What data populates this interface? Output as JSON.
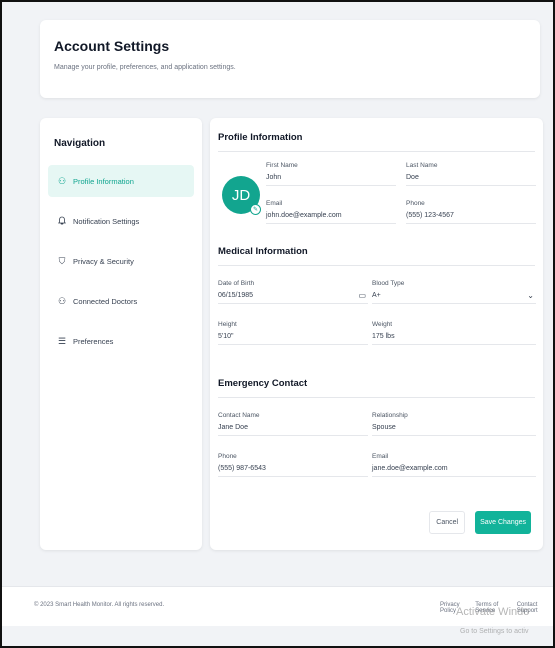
{
  "header": {
    "title": "Account Settings",
    "subtitle": "Manage your profile, preferences, and application settings."
  },
  "navigation": {
    "title": "Navigation",
    "items": [
      {
        "label": "Profile Information",
        "icon": "user-icon",
        "glyph": "⚇"
      },
      {
        "label": "Notification Settings",
        "icon": "bell-icon",
        "glyph": "🔔"
      },
      {
        "label": "Privacy & Security",
        "icon": "shield-icon",
        "glyph": "⛉"
      },
      {
        "label": "Connected Doctors",
        "icon": "users-icon",
        "glyph": "⚇"
      },
      {
        "label": "Preferences",
        "icon": "sliders-icon",
        "glyph": "☰"
      }
    ]
  },
  "profile": {
    "title": "Profile Information",
    "avatar_initials": "JD",
    "first_name_label": "First Name",
    "first_name": "John",
    "last_name_label": "Last Name",
    "last_name": "Doe",
    "email_label": "Email",
    "email": "john.doe@example.com",
    "phone_label": "Phone",
    "phone": "(555) 123-4567"
  },
  "medical": {
    "title": "Medical Information",
    "dob_label": "Date of Birth",
    "dob": "06/15/1985",
    "blood_label": "Blood Type",
    "blood": "A+",
    "height_label": "Height",
    "height": "5'10\"",
    "weight_label": "Weight",
    "weight": "175 lbs"
  },
  "emergency": {
    "title": "Emergency Contact",
    "contact_label": "Contact Name",
    "contact": "Jane Doe",
    "relationship_label": "Relationship",
    "relationship": "Spouse",
    "phone_label": "Phone",
    "phone": "(555) 987-6543",
    "email_label": "Email",
    "email": "jane.doe@example.com"
  },
  "actions": {
    "cancel": "Cancel",
    "save": "Save Changes"
  },
  "footer": {
    "copyright": "© 2023 Smart Health Monitor. All rights reserved.",
    "privacy": "Privacy Policy",
    "terms": "Terms of Service",
    "support": "Contact Support"
  },
  "watermark": {
    "line1": "Activate Windo",
    "line2": "Go to Settings to activ"
  },
  "colors": {
    "accent": "#12b39a",
    "active_bg": "#e6f7f4"
  }
}
